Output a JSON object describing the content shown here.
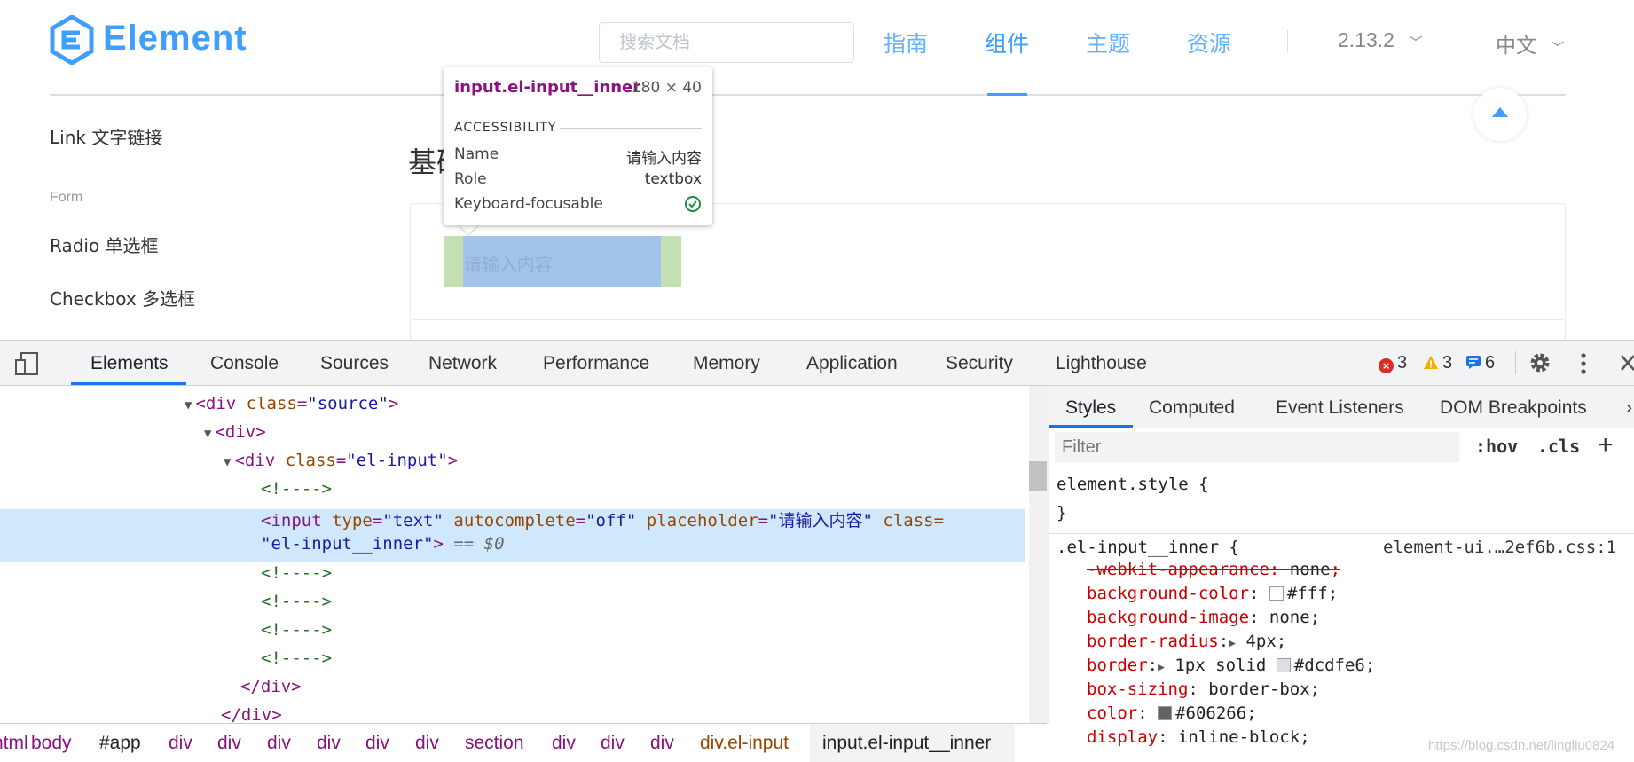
{
  "site": {
    "logo_text": "Element",
    "search_placeholder": "搜索文档",
    "nav": [
      "指南",
      "组件",
      "主题",
      "资源"
    ],
    "version": "2.13.2",
    "language": "中文"
  },
  "sidebar": {
    "link_item": "Link 文字链接",
    "group": "Form",
    "radio_item": "Radio 单选框",
    "checkbox_item": "Checkbox 多选框"
  },
  "content": {
    "heading": "基础用法",
    "input_placeholder": "请输入内容"
  },
  "tooltip": {
    "tag": "input.el-input__inner",
    "dimensions": "180 × 40",
    "section": "ACCESSIBILITY",
    "rows": [
      {
        "label": "Name",
        "value": "请输入内容"
      },
      {
        "label": "Role",
        "value": "textbox"
      },
      {
        "label": "Keyboard-focusable",
        "value": ""
      }
    ]
  },
  "devtools": {
    "tabs": [
      "Elements",
      "Console",
      "Sources",
      "Network",
      "Performance",
      "Memory",
      "Application",
      "Security",
      "Lighthouse"
    ],
    "errors": "3",
    "warnings": "3",
    "messages": "6",
    "elements": {
      "lines": [
        {
          "open": "<div ",
          "attr": "class",
          "val": "\"source\"",
          "close": ">"
        },
        {
          "open": "<div",
          "close": ">"
        },
        {
          "open": "<div ",
          "attr": "class",
          "val": "\"el-input\"",
          "close": ">"
        },
        {
          "comment": "<!---->"
        },
        {
          "input_part1": "<input ",
          "type_attr": "type",
          "type_val": "\"text\"",
          "ac_attr": " autocomplete",
          "ac_val": "\"off\"",
          "ph_attr": " placeholder",
          "ph_val": "\"请输入内容\"",
          "class_attr": " class=",
          "class_val": "\"el-input__inner\"",
          "end": ">",
          "dollar": " == $0"
        },
        {
          "comment": "<!---->"
        },
        {
          "comment": "<!---->"
        },
        {
          "comment": "<!---->"
        },
        {
          "comment": "<!---->"
        },
        {
          "closetag": "</div>"
        },
        {
          "closetag": "</div>"
        }
      ],
      "breadcrumbs": [
        "html",
        "body",
        "#app",
        "div",
        "div",
        "div",
        "div",
        "div",
        "div",
        "section",
        "div",
        "div",
        "div",
        "div.el-input",
        "input.el-input__inner"
      ]
    },
    "styles": {
      "tabs": [
        "Styles",
        "Computed",
        "Event Listeners",
        "DOM Breakpoints"
      ],
      "filter_placeholder": "Filter",
      "hov": ":hov",
      "cls": ".cls",
      "element_style_open": "element.style {",
      "element_style_close": "}",
      "rule_selector": ".el-input__inner {",
      "rule_source": "element-ui.…2ef6b.css:1",
      "props": [
        {
          "name": "-webkit-appearance",
          "value": "none",
          "struck": true
        },
        {
          "name": "background-color",
          "value": "#fff",
          "swatch": "#ffffff"
        },
        {
          "name": "background-image",
          "value": "none"
        },
        {
          "name": "border-radius",
          "value": "4px",
          "expand": true
        },
        {
          "name": "border",
          "value": "1px solid",
          "expand": true,
          "swatch": "#dcdfe6",
          "value2": "#dcdfe6"
        },
        {
          "name": "box-sizing",
          "value": "border-box"
        },
        {
          "name": "color",
          "value": "#606266",
          "swatch": "#606266"
        },
        {
          "name": "display",
          "value": "inline-block"
        }
      ]
    }
  },
  "watermark": "https://blog.csdn.net/lingliu0824",
  "colors": {
    "brand": "#409EFF",
    "tag": "#881280",
    "attr": "#994500",
    "value": "#1a1aa6"
  }
}
